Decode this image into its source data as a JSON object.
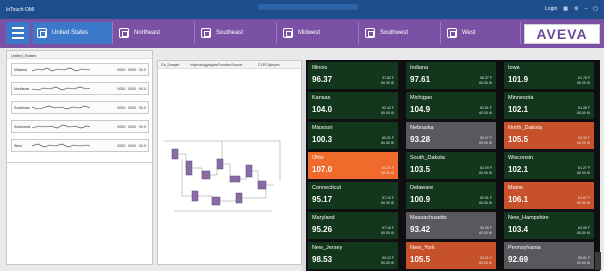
{
  "titlebar": {
    "app_title": "InTouch OMI",
    "right_label": "Login"
  },
  "nav": {
    "tabs": [
      {
        "label": "United States",
        "active": true
      },
      {
        "label": "Northeast",
        "active": false
      },
      {
        "label": "Southeast",
        "active": false
      },
      {
        "label": "Midwest",
        "active": false
      },
      {
        "label": "Southwest",
        "active": false
      },
      {
        "label": "West",
        "active": false
      }
    ],
    "logo": "AVEVA"
  },
  "left_panel": {
    "header": "United_States",
    "rows": [
      {
        "name": "Midwest",
        "values": "0000 · 0000 · 00.0"
      },
      {
        "name": "Northeast",
        "values": "0000 · 0000 · 00.0"
      },
      {
        "name": "Southeast",
        "values": "0000 · 0000 · 00.0"
      },
      {
        "name": "Southwest",
        "values": "0000 · 0000 · 00.0"
      },
      {
        "name": "West",
        "values": "0000 · 0000 · 00.0"
      }
    ]
  },
  "mid_panel": {
    "tabs": [
      "Gs_Sample",
      "InfgeneAggregateFunctionSource",
      "CVPC4yleyes"
    ]
  },
  "tiles": [
    {
      "name": "Illinois",
      "value": "96.37",
      "sub1": "37.82 F",
      "sub2": "60.00 ⚙",
      "color": "green"
    },
    {
      "name": "Indiana",
      "value": "97.61",
      "sub1": "58.37 F",
      "sub2": "60.00 ⚙",
      "color": "green"
    },
    {
      "name": "Iowa",
      "value": "101.9",
      "sub1": "61.76 F",
      "sub2": "60.00 ⚙",
      "color": "green"
    },
    {
      "name": "Kansas",
      "value": "104.0",
      "sub1": "62.42 F",
      "sub2": "60.00 ⚙",
      "color": "green"
    },
    {
      "name": "Michigan",
      "value": "104.9",
      "sub1": "62.91 F",
      "sub2": "60.00 ⚙",
      "color": "green"
    },
    {
      "name": "Minnesota",
      "value": "102.1",
      "sub1": "61.28 F",
      "sub2": "60.00 ⚙",
      "color": "green"
    },
    {
      "name": "Missouri",
      "value": "100.3",
      "sub1": "60.21 F",
      "sub2": "60.00 ⚙",
      "color": "green"
    },
    {
      "name": "Nebraska",
      "value": "93.28",
      "sub1": "55.97 F",
      "sub2": "60.00 ⚙",
      "color": "gray"
    },
    {
      "name": "North_Dakota",
      "value": "105.5",
      "sub1": "63.30 F",
      "sub2": "60.00 ⚙",
      "color": "orange"
    },
    {
      "name": "Ohio",
      "value": "107.0",
      "sub1": "64.21 F",
      "sub2": "60.00 ⚙",
      "color": "brightorange"
    },
    {
      "name": "South_Dakota",
      "value": "103.5",
      "sub1": "62.09 F",
      "sub2": "60.00 ⚙",
      "color": "green"
    },
    {
      "name": "Wisconsin",
      "value": "102.1",
      "sub1": "61.27 F",
      "sub2": "60.00 ⚙",
      "color": "green"
    },
    {
      "name": "Connecticut",
      "value": "95.17",
      "sub1": "57.10 F",
      "sub2": "60.00 ⚙",
      "color": "green"
    },
    {
      "name": "Delaware",
      "value": "100.9",
      "sub1": "60.51 F",
      "sub2": "60.00 ⚙",
      "color": "green"
    },
    {
      "name": "Maine",
      "value": "106.1",
      "sub1": "63.67 F",
      "sub2": "60.00 ⚙",
      "color": "orange"
    },
    {
      "name": "Maryland",
      "value": "95.26",
      "sub1": "57.16 F",
      "sub2": "60.00 ⚙",
      "color": "green"
    },
    {
      "name": "Massachusetts",
      "value": "93.42",
      "sub1": "56.05 F",
      "sub2": "60.00 ⚙",
      "color": "gray"
    },
    {
      "name": "New_Hampshire",
      "value": "103.4",
      "sub1": "62.05 F",
      "sub2": "60.00 ⚙",
      "color": "green"
    },
    {
      "name": "New_Jersey",
      "value": "98.53",
      "sub1": "59.12 F",
      "sub2": "60.00 ⚙",
      "color": "green"
    },
    {
      "name": "New_York",
      "value": "105.5",
      "sub1": "63.31 F",
      "sub2": "60.00 ⚙",
      "color": "orange"
    },
    {
      "name": "Pennsylvania",
      "value": "92.69",
      "sub1": "55.61 F",
      "sub2": "60.00 ⚙",
      "color": "gray"
    }
  ]
}
